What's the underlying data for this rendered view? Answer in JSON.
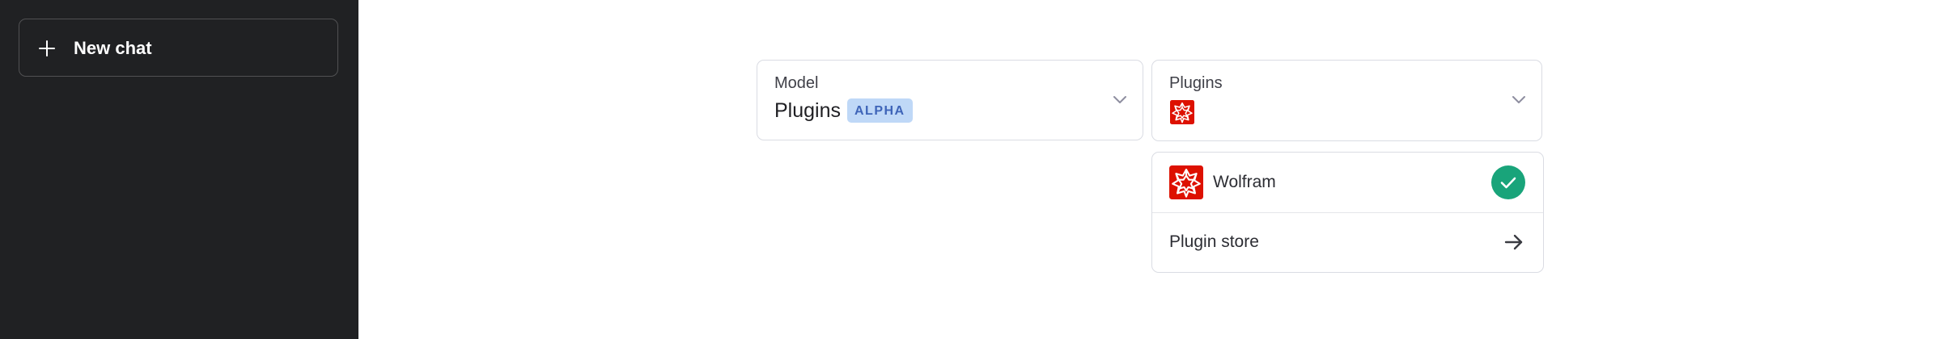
{
  "sidebar": {
    "new_chat_label": "New chat",
    "icon": "plus-icon"
  },
  "model_selector": {
    "caption": "Model",
    "value": "Plugins",
    "badge": "ALPHA",
    "icon": "chevron-down-icon"
  },
  "plugins_selector": {
    "caption": "Plugins",
    "enabled_plugin_icon": "wolfram-icon",
    "icon": "chevron-down-icon"
  },
  "plugins_dropdown": {
    "items": [
      {
        "label": "Wolfram",
        "icon": "wolfram-icon",
        "selected": true,
        "indicator": "check-icon"
      },
      {
        "label": "Plugin store",
        "indicator": "arrow-right-icon"
      }
    ]
  },
  "colors": {
    "sidebar_bg": "#202123",
    "badge_bg": "#bfd8f7",
    "badge_text": "#3e64b8",
    "wolfram_red": "#dd1100",
    "check_green": "#19a47a"
  }
}
